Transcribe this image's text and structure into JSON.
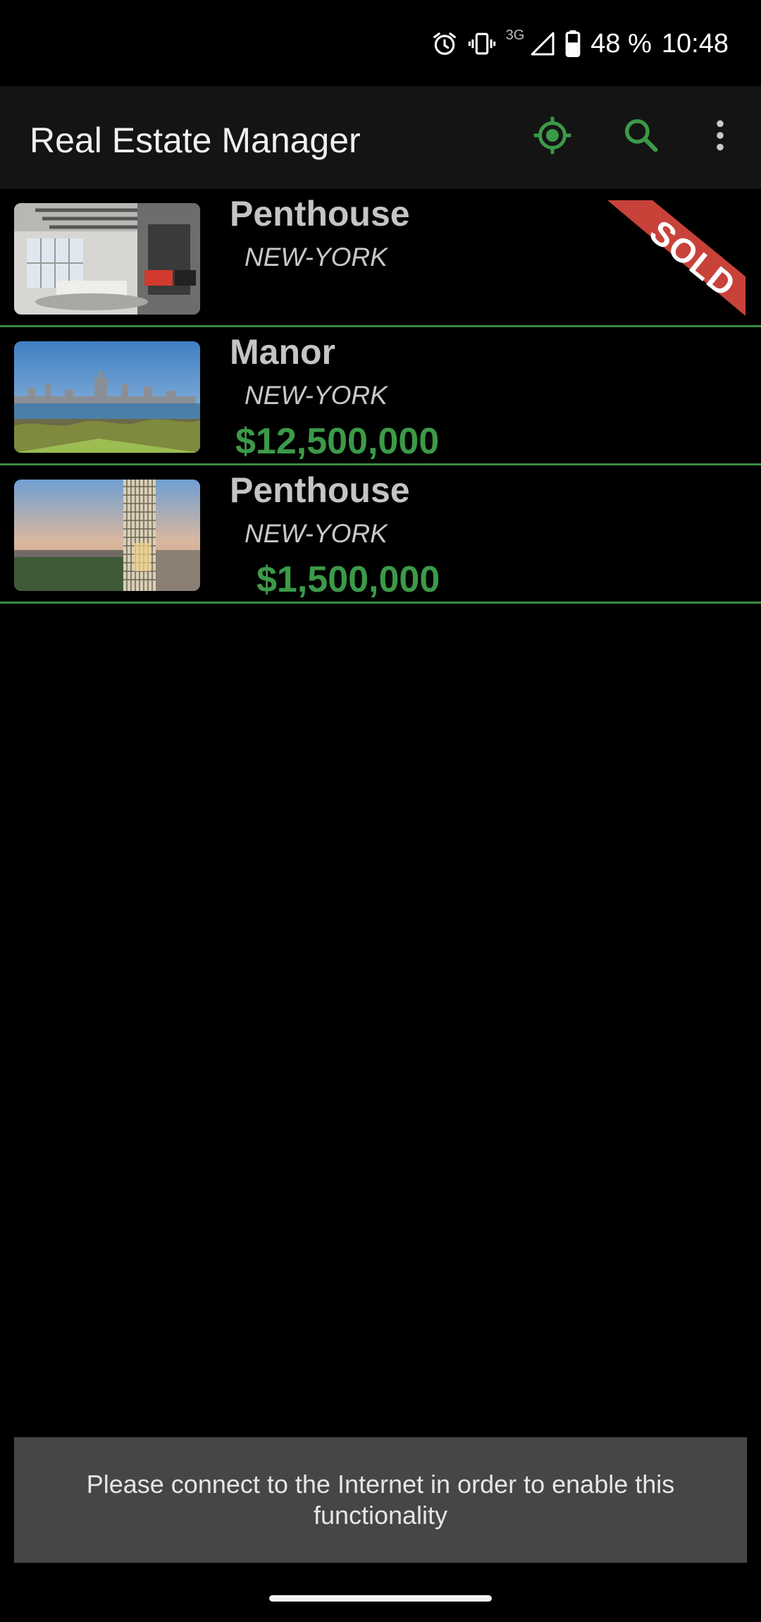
{
  "status_bar": {
    "network": "3G",
    "battery": "48 %",
    "time": "10:48",
    "icons": [
      "alarm-icon",
      "vibrate-icon",
      "signal-icon",
      "battery-icon"
    ]
  },
  "app_bar": {
    "title": "Real Estate Manager",
    "actions": [
      "location-icon",
      "search-icon",
      "more-vert-icon"
    ]
  },
  "colors": {
    "accent": "#3c9a48",
    "divider": "#3a8a45",
    "sold_ribbon": "#c8423a",
    "snackbar_bg": "#464646"
  },
  "properties": [
    {
      "type": "Penthouse",
      "city": "NEW-YORK",
      "price": "",
      "badge": "SOLD"
    },
    {
      "type": "Manor",
      "city": "NEW-YORK",
      "price": "$12,500,000",
      "badge": ""
    },
    {
      "type": "Penthouse",
      "city": "NEW-YORK",
      "price": "$1,500,000",
      "badge": ""
    }
  ],
  "snackbar": {
    "message": "Please connect to the Internet in order to enable this functionality"
  }
}
